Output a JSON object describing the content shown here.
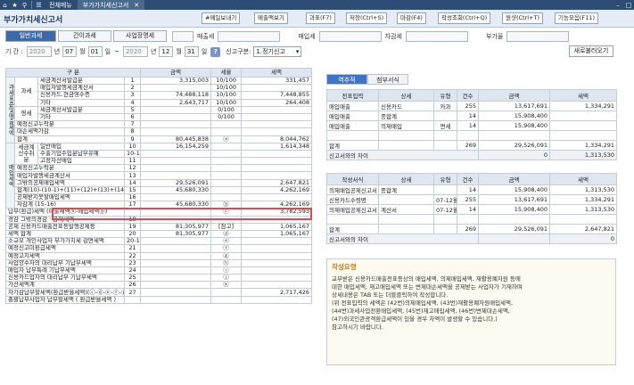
{
  "topbar": {
    "tab_all": "전체메뉴",
    "tab_current": "부가가치세신고서"
  },
  "window": {
    "title": "부가가치세신고서"
  },
  "toolbar": {
    "buttons": [
      "#메일보내기",
      "메출액보기",
      "과표(F7)",
      "저장(Ctrl+S)",
      "마감(F4)",
      "작성조회(Ctrl+Q)",
      "원샷(Ctrl+T)",
      "기능모음(F11)"
    ]
  },
  "filters": {
    "tabs": [
      "일반과세",
      "간이과세",
      "사업장명세"
    ],
    "labels": {
      "sales": "매출세",
      "purchase": "매입세",
      "payable": "차감세",
      "vat": "부가율"
    },
    "period_label": "기 간 :",
    "year_from": "2020",
    "year_unit": "년",
    "month_from": "07",
    "month_unit": "월",
    "day_from": "01",
    "day_unit": "일",
    "tilde": "~",
    "year_to": "2020",
    "month_to": "12",
    "day_to": "31",
    "report_label": "신고구분:",
    "report_value": "1.정기신고",
    "reload": "새로불러오기"
  },
  "left_table": {
    "headers": {
      "cat": "구 분",
      "amount": "금액",
      "rate": "세율",
      "tax": "세액"
    },
    "side_labels": {
      "s1": "과세표준및매출세액",
      "s1a": "과세",
      "s1b": "영세",
      "s2": "매입세액",
      "s2a": "세금계산수취분"
    },
    "rows": [
      {
        "label": "세금계산서발급분",
        "no": "1",
        "amount": "3,315,003",
        "rate": "10/100",
        "tax": "331,457"
      },
      {
        "label": "매입자발행세금계산서",
        "no": "2",
        "amount": "",
        "rate": "10/100",
        "tax": ""
      },
      {
        "label": "신용카드.현금영수증",
        "no": "3",
        "amount": "74,488,118",
        "rate": "10/100",
        "tax": "7,448,855"
      },
      {
        "label": "기타",
        "no": "4",
        "amount": "2,643,717",
        "rate": "10/100",
        "tax": "264,408"
      },
      {
        "label": "세금계산서발급분",
        "no": "5",
        "amount": "",
        "rate": "0/100",
        "tax": ""
      },
      {
        "label": "기타",
        "no": "6",
        "amount": "",
        "rate": "0/100",
        "tax": ""
      },
      {
        "label": "예정신고누락분",
        "no": "7",
        "amount": "",
        "rate": "",
        "tax": ""
      },
      {
        "label": "대손세액가감",
        "no": "8",
        "amount": "",
        "rate": "",
        "tax": ""
      },
      {
        "label": "합계",
        "no": "9",
        "amount": "80,445,838",
        "rate": "ⓐ",
        "tax": "8,044,762"
      },
      {
        "label": "일반매입",
        "no": "10",
        "amount": "16,154,259",
        "rate": "",
        "tax": "1,614,348"
      },
      {
        "label": "수출기업수입분납부유예",
        "no": "10-1",
        "amount": "",
        "rate": "",
        "tax": ""
      },
      {
        "label": "고정자산매입",
        "no": "11",
        "amount": "",
        "rate": "",
        "tax": ""
      },
      {
        "label": "예정신고누락분",
        "no": "12",
        "amount": "",
        "rate": "",
        "tax": ""
      },
      {
        "label": "매입자발행세금계산서",
        "no": "13",
        "amount": "",
        "rate": "",
        "tax": ""
      },
      {
        "label": "그밖의공제매입세액",
        "no": "14",
        "amount": "29,526,091",
        "rate": "",
        "tax": "2,647,821"
      },
      {
        "label": "합계(10)-(10-1)+(11)+(12)+(13)+(14)",
        "no": "15",
        "amount": "45,680,330",
        "rate": "",
        "tax": "4,262,169"
      },
      {
        "label": "공제받지못할매입세액",
        "no": "16",
        "amount": "",
        "rate": "",
        "tax": ""
      },
      {
        "label": "차감계 (15-16)",
        "no": "17",
        "amount": "45,680,330",
        "rate": "ⓑ",
        "tax": "4,262,169"
      },
      {
        "label": "납부(환급)세액 (매출세액ⓐ-매입세액ⓑ)",
        "no": "",
        "amount": "",
        "rate": "ⓒ",
        "tax": "3,782,593"
      },
      {
        "label": "경감 그밖의경감 · 공제세액",
        "no": "18",
        "amount": "",
        "rate": "",
        "tax": ""
      },
      {
        "label": "공제 신용카드매출전표등발행공제등",
        "no": "19",
        "amount": "81,305,977",
        "rate": "[참고]",
        "tax": "1,065,167"
      },
      {
        "label": "세액 합계",
        "no": "20",
        "amount": "81,305,977",
        "rate": "ⓓ",
        "tax": "1,065,167"
      },
      {
        "label": "소규모 개인사업자 부가가치세 감면세액",
        "no": "20-1",
        "amount": "",
        "rate": "ⓔ",
        "tax": ""
      },
      {
        "label": "예정신고미환급세액",
        "no": "21",
        "amount": "",
        "rate": "ⓕ",
        "tax": ""
      },
      {
        "label": "예정고지세액",
        "no": "22",
        "amount": "",
        "rate": "ⓖ",
        "tax": ""
      },
      {
        "label": "사업양수자의 대리납부 기납부세액",
        "no": "23",
        "amount": "",
        "rate": "ⓗ",
        "tax": ""
      },
      {
        "label": "매입자 납부특례 기납부세액",
        "no": "24",
        "amount": "",
        "rate": "ⓘ",
        "tax": ""
      },
      {
        "label": "신용카드업자의 대리납부 기납부세액",
        "no": "25",
        "amount": "",
        "rate": "ⓙ",
        "tax": ""
      },
      {
        "label": "가산세액계",
        "no": "26",
        "amount": "",
        "rate": "ⓚ",
        "tax": ""
      },
      {
        "label": "차가감납부할세액(환급받을세액)(ⓒ-ⓓ-ⓔ-ⓕ-ⓖ-ⓗ-ⓘ-ⓙ+ⓚ)",
        "no": "27",
        "amount": "",
        "rate": "",
        "tax": "2,717,426"
      },
      {
        "label": "총괄납부사업자 납부할세액 ( 환급받을세액 )",
        "no": "",
        "amount": "",
        "rate": "",
        "tax": ""
      }
    ]
  },
  "right": {
    "tabs": [
      "역추적",
      "첨부서식"
    ],
    "table1": {
      "headers": [
        "전표입력",
        "상세",
        "유형",
        "건수",
        "금액",
        "세액"
      ],
      "rows": [
        [
          "매입매출",
          "신용카드",
          "카과",
          "255",
          "13,617,691",
          "1,334,291"
        ],
        [
          "매입매출",
          "종합계",
          "",
          "14",
          "15,908,400",
          ""
        ],
        [
          "매입매출",
          "의제매입",
          "면세",
          "14",
          "15,908,400",
          ""
        ],
        [
          "",
          "",
          "",
          "",
          "",
          ""
        ],
        [
          "합계",
          "",
          "",
          "269",
          "29,526,091",
          "1,334,291"
        ]
      ],
      "diff": [
        "신고서와의 차이",
        "0",
        "1,313,530"
      ]
    },
    "table2": {
      "headers": [
        "작성서식",
        "상세",
        "유형",
        "건수",
        "금액",
        "세액"
      ],
      "rows": [
        [
          "의제매입공제신고서",
          "종합계",
          "",
          "14",
          "15,908,400",
          "1,313,530"
        ],
        [
          "신용카드수령명",
          "",
          "07-12월",
          "255",
          "13,617,691",
          "1,334,291"
        ],
        [
          "의제매입공제신고서",
          "계산서",
          "07-12월",
          "14",
          "15,908,400",
          "1,313,530"
        ],
        [
          "",
          "",
          "",
          "",
          "",
          ""
        ],
        [
          "합계",
          "",
          "",
          "269",
          "29,526,091",
          "2,647,821"
        ]
      ],
      "diff": [
        "신고서와의 차이",
        "",
        "0"
      ]
    },
    "notes": {
      "title": "작성요령",
      "text": "교부받은 신용카드매출전표등상의 매입세액, 의제매입세액, 재활용폐자원 등에\n대한 매입세액, 재고매입세액 또는 변제대손세액을 공제받는 사업자가 기재하며\n상세내용은 TAB 또는 더블클릭하여 작성합니다.\n(위 전표입력의 세액은 (42번)의제매입세액, (43번)재활용폐자원매입세액,\n(44번)과세사업전환매입세액, (45번)재고매입세액, (46번)변제대손세액,\n(47)외국인관광객환급세액이 있을 경우 차액이 발생할 수 있습니다.)\n참고하시기 바랍니다."
    }
  }
}
